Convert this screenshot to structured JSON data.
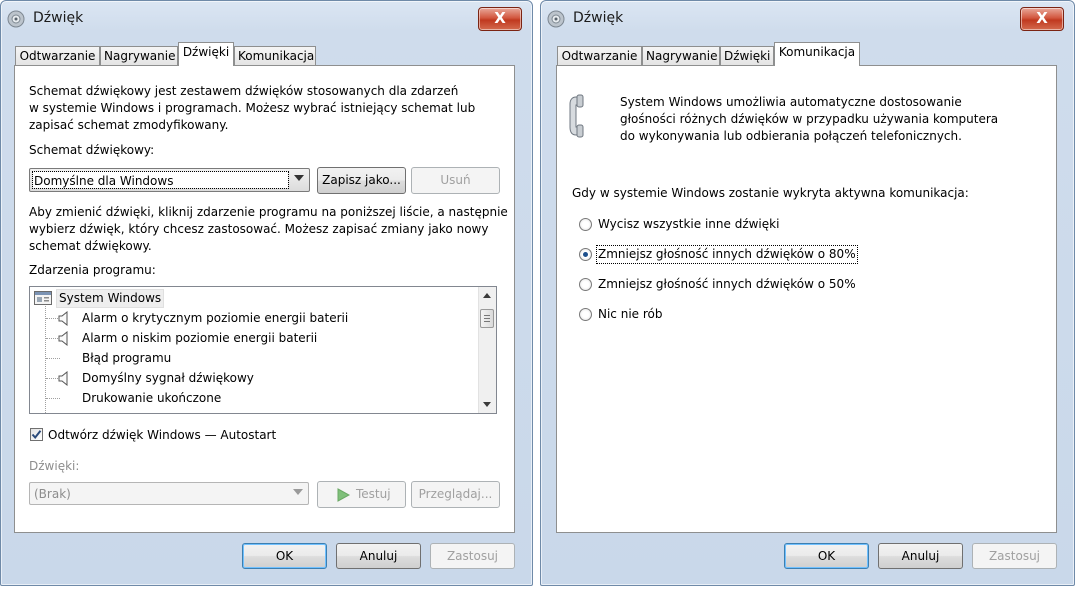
{
  "dialogs": [
    {
      "title": "Dźwięk",
      "close_label": "X",
      "tabs": [
        "Odtwarzanie",
        "Nagrywanie",
        "Dźwięki",
        "Komunikacja"
      ],
      "active_tab": "Dźwięki",
      "intro": "Schemat dźwiękowy jest zestawem dźwięków stosowanych dla zdarzeń w systemie Windows i programach. Możesz wybrać istniejący schemat lub zapisać schemat zmodyfikowany.",
      "intro_lines": [
        "Schemat dźwiękowy jest zestawem dźwięków stosowanych dla zdarzeń",
        "w systemie Windows i programach. Możesz wybrać istniejący schemat lub",
        "zapisać schemat zmodyfikowany."
      ],
      "scheme_label": "Schemat dźwiękowy:",
      "scheme_value": "Domyślne dla Windows",
      "save_as_label": "Zapisz jako...",
      "delete_label": "Usuń",
      "change_lines": [
        "Aby zmienić dźwięki, kliknij zdarzenie programu na poniższej liście, a następnie",
        "wybierz dźwięk, który chcesz zastosować. Możesz zapisać zmiany jako nowy",
        "schemat dźwiękowy."
      ],
      "events_label": "Zdarzenia programu:",
      "events": [
        {
          "label": "System Windows",
          "icon": "system-windows-icon",
          "level": 0
        },
        {
          "label": "Alarm o krytycznym poziomie energii baterii",
          "icon": "speaker-icon",
          "level": 1
        },
        {
          "label": "Alarm o niskim poziomie energii baterii",
          "icon": "speaker-icon",
          "level": 1
        },
        {
          "label": "Błąd programu",
          "icon": "",
          "level": 1
        },
        {
          "label": "Domyślny sygnał dźwiękowy",
          "icon": "speaker-icon",
          "level": 1
        },
        {
          "label": "Drukowanie ukończone",
          "icon": "",
          "level": 1
        }
      ],
      "autostart_label": "Odtwórz dźwięk Windows — Autostart",
      "autostart_checked": true,
      "sounds_label": "Dźwięki:",
      "sounds_value": "(Brak)",
      "test_label": "Testuj",
      "browse_label": "Przeglądaj...",
      "ok_label": "OK",
      "cancel_label": "Anuluj",
      "apply_label": "Zastosuj"
    },
    {
      "title": "Dźwięk",
      "close_label": "X",
      "tabs": [
        "Odtwarzanie",
        "Nagrywanie",
        "Dźwięki",
        "Komunikacja"
      ],
      "active_tab": "Komunikacja",
      "info_lines": [
        "System Windows umożliwia automatyczne dostosowanie",
        "głośności różnych dźwięków w przypadku używania komputera",
        "do wykonywania lub odbierania połączeń telefonicznych."
      ],
      "question": "Gdy w systemie Windows zostanie wykryta aktywna komunikacja:",
      "options": [
        {
          "label": "Wycisz wszystkie inne dźwięki",
          "selected": false
        },
        {
          "label": "Zmniejsz głośność innych dźwięków o 80%",
          "selected": true
        },
        {
          "label": "Zmniejsz głośność innych dźwięków o 50%",
          "selected": false
        },
        {
          "label": "Nic nie rób",
          "selected": false
        }
      ],
      "ok_label": "OK",
      "cancel_label": "Anuluj",
      "apply_label": "Zastosuj"
    }
  ]
}
